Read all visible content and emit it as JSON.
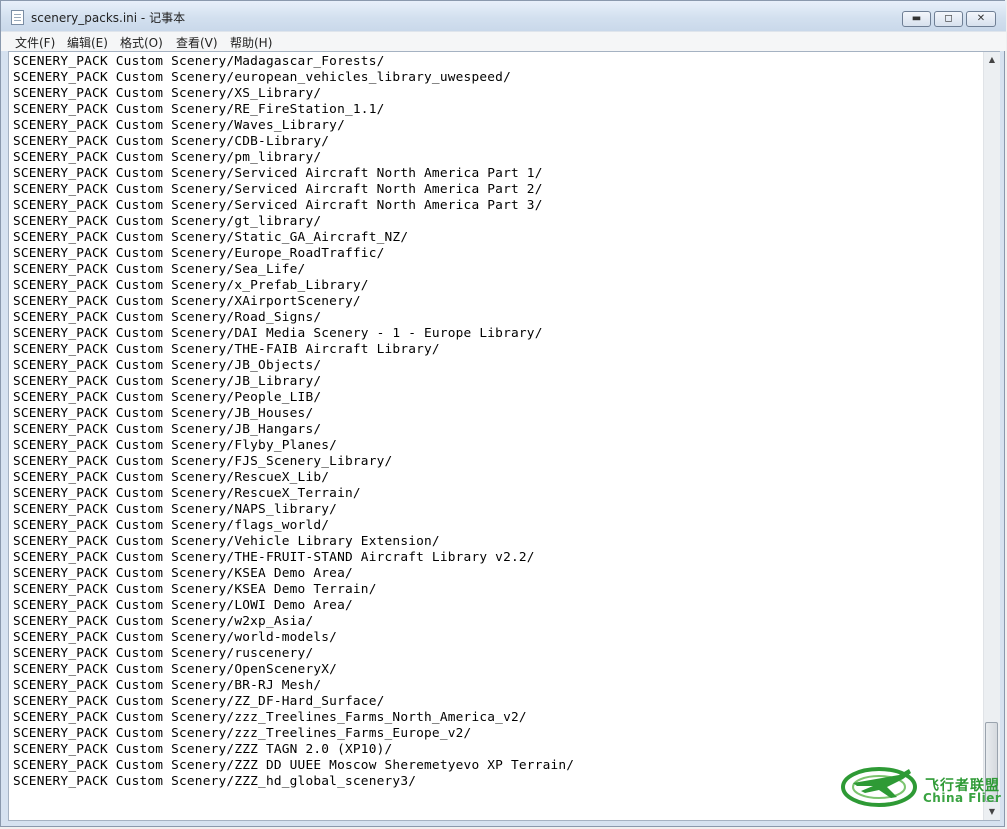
{
  "window": {
    "title": "scenery_packs.ini - 记事本",
    "minimize_icon": "minimize-icon",
    "maximize_icon": "maximize-icon",
    "close_icon": "close-icon"
  },
  "menu": {
    "file": "文件(F)",
    "edit": "编辑(E)",
    "format": "格式(O)",
    "view": "查看(V)",
    "help": "帮助(H)"
  },
  "editor": {
    "lines": [
      "SCENERY_PACK Custom Scenery/Madagascar_Forests/",
      "SCENERY_PACK Custom Scenery/european_vehicles_library_uwespeed/",
      "SCENERY_PACK Custom Scenery/XS_Library/",
      "SCENERY_PACK Custom Scenery/RE_FireStation_1.1/",
      "SCENERY_PACK Custom Scenery/Waves_Library/",
      "SCENERY_PACK Custom Scenery/CDB-Library/",
      "SCENERY_PACK Custom Scenery/pm_library/",
      "SCENERY_PACK Custom Scenery/Serviced Aircraft North America Part 1/",
      "SCENERY_PACK Custom Scenery/Serviced Aircraft North America Part 2/",
      "SCENERY_PACK Custom Scenery/Serviced Aircraft North America Part 3/",
      "SCENERY_PACK Custom Scenery/gt_library/",
      "SCENERY_PACK Custom Scenery/Static_GA_Aircraft_NZ/",
      "SCENERY_PACK Custom Scenery/Europe_RoadTraffic/",
      "SCENERY_PACK Custom Scenery/Sea_Life/",
      "SCENERY_PACK Custom Scenery/x_Prefab_Library/",
      "SCENERY_PACK Custom Scenery/XAirportScenery/",
      "SCENERY_PACK Custom Scenery/Road_Signs/",
      "SCENERY_PACK Custom Scenery/DAI Media Scenery - 1 - Europe Library/",
      "SCENERY_PACK Custom Scenery/THE-FAIB Aircraft Library/",
      "SCENERY_PACK Custom Scenery/JB_Objects/",
      "SCENERY_PACK Custom Scenery/JB_Library/",
      "SCENERY_PACK Custom Scenery/People_LIB/",
      "SCENERY_PACK Custom Scenery/JB_Houses/",
      "SCENERY_PACK Custom Scenery/JB_Hangars/",
      "SCENERY_PACK Custom Scenery/Flyby_Planes/",
      "SCENERY_PACK Custom Scenery/FJS_Scenery_Library/",
      "SCENERY_PACK Custom Scenery/RescueX_Lib/",
      "SCENERY_PACK Custom Scenery/RescueX_Terrain/",
      "SCENERY_PACK Custom Scenery/NAPS_library/",
      "SCENERY_PACK Custom Scenery/flags_world/",
      "SCENERY_PACK Custom Scenery/Vehicle Library Extension/",
      "SCENERY_PACK Custom Scenery/THE-FRUIT-STAND Aircraft Library v2.2/",
      "SCENERY_PACK Custom Scenery/KSEA Demo Area/",
      "SCENERY_PACK Custom Scenery/KSEA Demo Terrain/",
      "SCENERY_PACK Custom Scenery/LOWI Demo Area/",
      "SCENERY_PACK Custom Scenery/w2xp_Asia/",
      "SCENERY_PACK Custom Scenery/world-models/",
      "SCENERY_PACK Custom Scenery/ruscenery/",
      "SCENERY_PACK Custom Scenery/OpenSceneryX/",
      "SCENERY_PACK Custom Scenery/BR-RJ Mesh/",
      "SCENERY_PACK Custom Scenery/ZZ_DF-Hard_Surface/",
      "SCENERY_PACK Custom Scenery/zzz_Treelines_Farms_North_America_v2/",
      "SCENERY_PACK Custom Scenery/zzz_Treelines_Farms_Europe_v2/",
      "SCENERY_PACK Custom Scenery/ZZZ TAGN 2.0 (XP10)/",
      "SCENERY_PACK Custom Scenery/ZZZ DD UUEE Moscow Sheremetyevo XP Terrain/",
      "SCENERY_PACK Custom Scenery/ZZZ_hd_global_scenery3/"
    ]
  },
  "watermark": {
    "text_cn": "飞行者联盟",
    "text_en": "China Flier",
    "logo_icon": "plane-logo-icon",
    "accent_color": "#2e9a35"
  }
}
